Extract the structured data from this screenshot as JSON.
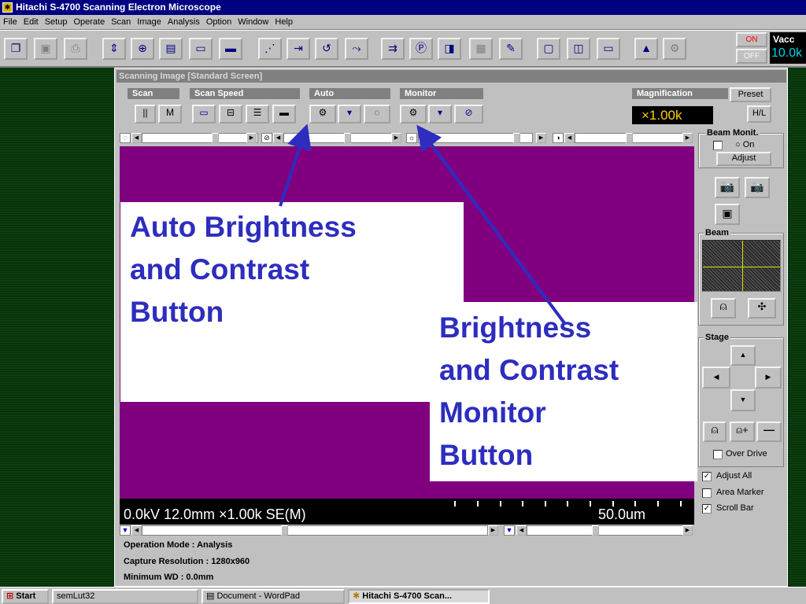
{
  "app": {
    "title": "Hitachi S-4700 Scanning Electron Microscope"
  },
  "menu": [
    "File",
    "Edit",
    "Setup",
    "Operate",
    "Scan",
    "Image",
    "Analysis",
    "Option",
    "Window",
    "Help"
  ],
  "toolbar": {
    "buttons": [
      "window-icon",
      "save-icon",
      "print-icon",
      "focus-icon",
      "crosshair-icon",
      "display-mode-icon",
      "split-screen-icon",
      "data-display-icon",
      "scan-rotation-icon",
      "stigma-icon",
      "align-icon",
      "tilt-icon",
      "detector-icon",
      "p-signal-icon",
      "mix-signal-icon",
      "merge-icon",
      "edit-icon",
      "window-layout-icon",
      "dual-window-icon",
      "full-window-icon",
      "histogram-icon",
      "pci-icon"
    ],
    "hv_on": "ON",
    "hv_off": "OFF",
    "vacc_label": "Vacc",
    "vacc_value": "10.0k"
  },
  "window": {
    "title": "Scanning Image [Standard Screen]",
    "groups": {
      "scan": "Scan",
      "scan_speed": "Scan Speed",
      "auto": "Auto",
      "monitor": "Monitor",
      "magnification": "Magnification"
    },
    "scan_buttons": {
      "freeze": "||",
      "memory": "M"
    },
    "auto_buttons": [
      "brightness-contrast-icon",
      "focus-icon",
      "stigma-icon"
    ],
    "monitor_buttons": [
      "brightness-contrast-icon",
      "focus-icon",
      "stigma-icon"
    ],
    "magnification": {
      "preset_label": "Preset",
      "value": "×1.00k",
      "hl_label": "H/L"
    },
    "info_line": "0.0kV 12.0mm ×1.00k SE(M)",
    "scale_text": "50.0um",
    "status": {
      "operation_mode": "Operation Mode : Analysis",
      "capture_resolution": "Capture Resolution : 1280x960",
      "minimum_wd": "Minimum WD : 0.0mm"
    }
  },
  "right_panel": {
    "beam_monit_label": "Beam Monit.",
    "on_label": "On",
    "adjust_label": "Adjust",
    "beam_label": "Beam",
    "stage_label": "Stage",
    "over_drive_label": "Over Drive",
    "checks": [
      {
        "label": "Adjust All",
        "checked": true
      },
      {
        "label": "Area Marker",
        "checked": false
      },
      {
        "label": "Scroll Bar",
        "checked": true
      }
    ]
  },
  "callouts": {
    "auto_bc": [
      "Auto Brightness",
      "and Contrast",
      "Button"
    ],
    "monitor_bc": [
      "Brightness",
      "and Contrast",
      "Monitor",
      "Button"
    ]
  },
  "taskbar": {
    "start": "Start",
    "items": [
      "semLut32",
      "Document - WordPad",
      "Hitachi S-4700 Scan..."
    ]
  },
  "colors": {
    "image_area": "#800080",
    "callout_text": "#2d2dbf",
    "titlebar": "#000080"
  }
}
